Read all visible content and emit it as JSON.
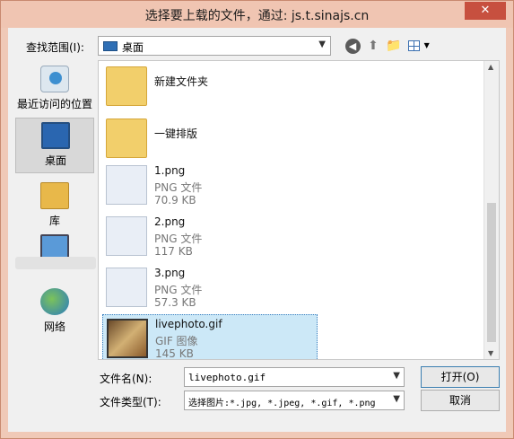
{
  "window": {
    "title": "选择要上载的文件，通过: js.t.sinajs.cn",
    "close_label": "✕"
  },
  "toolbar": {
    "lookin_label": "查找范围(I):",
    "lookin_value": "桌面",
    "back_icon": "back-icon",
    "up_icon": "up-folder-icon",
    "newfolder_icon": "new-folder-icon",
    "view_icon": "view-menu-icon"
  },
  "places": [
    {
      "label": "最近访问的位置",
      "icon": "recent-icon"
    },
    {
      "label": "桌面",
      "icon": "desktop-icon",
      "selected": true
    },
    {
      "label": "库",
      "icon": "library-icon"
    },
    {
      "label": "",
      "icon": "computer-icon"
    },
    {
      "label": "网络",
      "icon": "network-icon"
    }
  ],
  "files": [
    {
      "name": "新建文件夹",
      "kind": "folder"
    },
    {
      "name": "一键排版",
      "kind": "folder"
    },
    {
      "name": "1.png",
      "type": "PNG 文件",
      "size": "70.9 KB"
    },
    {
      "name": "2.png",
      "type": "PNG 文件",
      "size": "117 KB"
    },
    {
      "name": "3.png",
      "type": "PNG 文件",
      "size": "57.3 KB"
    },
    {
      "name": "livephoto.gif",
      "type": "GIF 图像",
      "size": "145 KB",
      "selected": true
    }
  ],
  "bottom": {
    "filename_label": "文件名(N):",
    "filename_value": "livephoto.gif",
    "filetype_label": "文件类型(T):",
    "filetype_value": "选择图片:*.jpg, *.jpeg, *.gif, *.png",
    "open_label": "打开(O)",
    "cancel_label": "取消"
  }
}
